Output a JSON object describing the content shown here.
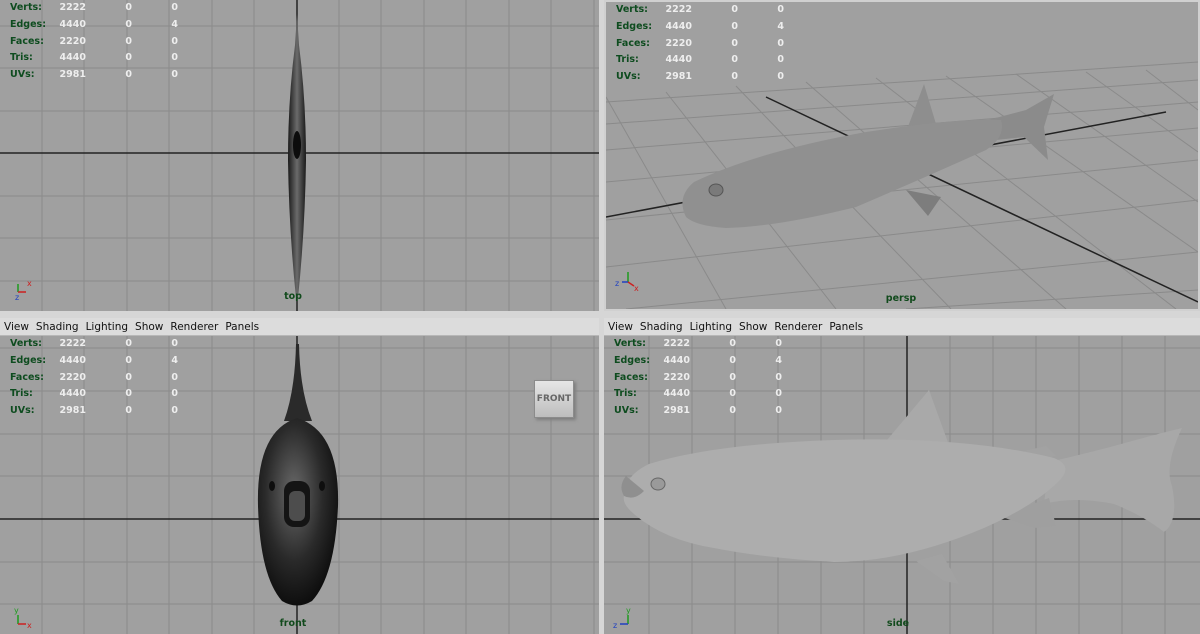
{
  "menu": [
    "View",
    "Shading",
    "Lighting",
    "Show",
    "Renderer",
    "Panels"
  ],
  "hud": {
    "rows": [
      {
        "label": "Verts:",
        "values": [
          "2222",
          "0",
          "0"
        ]
      },
      {
        "label": "Edges:",
        "values": [
          "4440",
          "0",
          "4"
        ]
      },
      {
        "label": "Faces:",
        "values": [
          "2220",
          "0",
          "0"
        ]
      },
      {
        "label": "Tris:",
        "values": [
          "4440",
          "0",
          "0"
        ]
      },
      {
        "label": "UVs:",
        "values": [
          "2981",
          "0",
          "0"
        ]
      }
    ]
  },
  "panels": {
    "top": {
      "camera": "top"
    },
    "persp": {
      "camera": "persp"
    },
    "front": {
      "camera": "front",
      "viewcube": "FRONT"
    },
    "side": {
      "camera": "side"
    }
  },
  "axes": {
    "x": "x",
    "y": "y",
    "z": "z"
  },
  "colors": {
    "viewport_bg": "#a0a0a0",
    "grid": "#888888",
    "axis_line": "#222222",
    "hud_label": "#0e4c1f",
    "hud_value": "#eeeeee"
  }
}
